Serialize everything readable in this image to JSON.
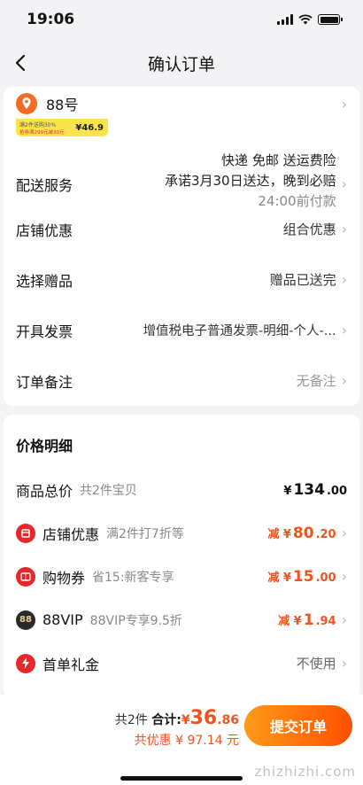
{
  "status": {
    "time": "19:06"
  },
  "nav": {
    "title": "确认订单"
  },
  "address": {
    "text": "88号"
  },
  "promo": {
    "line1": "满2件送购30%",
    "line2": "抢券满299元减30元",
    "price": "¥46.9"
  },
  "delivery": {
    "label": "配送服务",
    "line1": "快递 免邮 送运费险",
    "line2": "承诺3月30日送达，晚到必赔",
    "line3": "24:00前付款"
  },
  "rows": [
    {
      "label": "店铺优惠",
      "value": "组合优惠"
    },
    {
      "label": "选择赠品",
      "value": "赠品已送完"
    },
    {
      "label": "开具发票",
      "value": "增值税电子普通发票-明细-个人-..."
    },
    {
      "label": "订单备注",
      "value": "无备注"
    }
  ],
  "price_detail": {
    "title": "价格明细",
    "total": {
      "name": "商品总价",
      "desc": "共2件宝贝",
      "yen": "¥",
      "int": "134",
      "dec": ".00"
    },
    "shop_discount": {
      "name": "店铺优惠",
      "desc": "满2件打7折等",
      "prefix": "减 ¥",
      "int": "80",
      "dec": ".20"
    },
    "coupon": {
      "name": "购物券",
      "desc": "省15:新客专享",
      "prefix": "减 ¥",
      "int": "15",
      "dec": ".00"
    },
    "vip": {
      "name": "88VIP",
      "desc": "88VIP专享9.5折",
      "prefix": "减 ¥",
      "int": "1",
      "dec": ".94",
      "badge": "88"
    },
    "first": {
      "name": "首单礼金",
      "value": "不使用"
    }
  },
  "bottom": {
    "count": "共2件",
    "sum_label": "合计:",
    "yen": "¥",
    "int": "36",
    "dec": ".86",
    "saved": "共优惠 ¥ 97.14 元",
    "submit": "提交订单"
  },
  "watermark": "zhizhizhi.com",
  "colors": {
    "accent": "#f0541e",
    "button_start": "#ff9a18",
    "button_end": "#ff5000"
  }
}
